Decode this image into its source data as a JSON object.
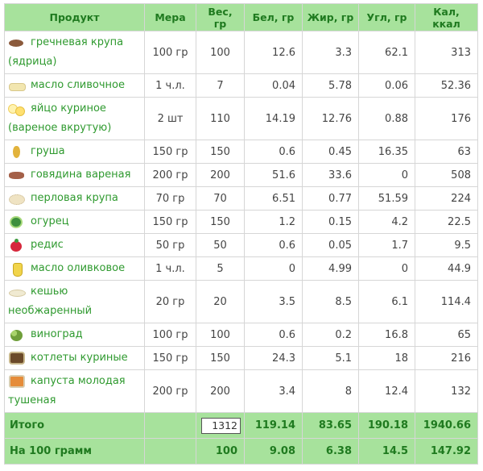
{
  "columns": [
    "Продукт",
    "Мера",
    "Вес, гр",
    "Бел, гр",
    "Жир, гр",
    "Угл, гр",
    "Кал, ккал"
  ],
  "rows": [
    {
      "icon": "buckwheat-icon",
      "name": "гречневая крупа (ядрица)",
      "measure": "100 гр",
      "weight": "100",
      "protein": "12.6",
      "fat": "3.3",
      "carbs": "62.1",
      "kcal": "313"
    },
    {
      "icon": "butter-icon",
      "name": "масло сливочное",
      "measure": "1 ч.л.",
      "weight": "7",
      "protein": "0.04",
      "fat": "5.78",
      "carbs": "0.06",
      "kcal": "52.36"
    },
    {
      "icon": "egg-icon",
      "name": "яйцо куриное (вареное вкрутую)",
      "measure": "2 шт",
      "weight": "110",
      "protein": "14.19",
      "fat": "12.76",
      "carbs": "0.88",
      "kcal": "176"
    },
    {
      "icon": "pear-icon",
      "name": "груша",
      "measure": "150 гр",
      "weight": "150",
      "protein": "0.6",
      "fat": "0.45",
      "carbs": "16.35",
      "kcal": "63"
    },
    {
      "icon": "beef-icon",
      "name": "говядина вареная",
      "measure": "200 гр",
      "weight": "200",
      "protein": "51.6",
      "fat": "33.6",
      "carbs": "0",
      "kcal": "508"
    },
    {
      "icon": "barley-icon",
      "name": "перловая крупа",
      "measure": "70 гр",
      "weight": "70",
      "protein": "6.51",
      "fat": "0.77",
      "carbs": "51.59",
      "kcal": "224"
    },
    {
      "icon": "cucumber-icon",
      "name": "огурец",
      "measure": "150 гр",
      "weight": "150",
      "protein": "1.2",
      "fat": "0.15",
      "carbs": "4.2",
      "kcal": "22.5"
    },
    {
      "icon": "radish-icon",
      "name": "редис",
      "measure": "50 гр",
      "weight": "50",
      "protein": "0.6",
      "fat": "0.05",
      "carbs": "1.7",
      "kcal": "9.5"
    },
    {
      "icon": "olive-oil-icon",
      "name": "масло оливковое",
      "measure": "1 ч.л.",
      "weight": "5",
      "protein": "0",
      "fat": "4.99",
      "carbs": "0",
      "kcal": "44.9"
    },
    {
      "icon": "cashew-icon",
      "name": "кешью необжаренный",
      "measure": "20 гр",
      "weight": "20",
      "protein": "3.5",
      "fat": "8.5",
      "carbs": "6.1",
      "kcal": "114.4"
    },
    {
      "icon": "grape-icon",
      "name": "виноград",
      "measure": "100 гр",
      "weight": "100",
      "protein": "0.6",
      "fat": "0.2",
      "carbs": "16.8",
      "kcal": "65"
    },
    {
      "icon": "cutlet-icon",
      "name": "котлеты куриные",
      "measure": "150 гр",
      "weight": "150",
      "protein": "24.3",
      "fat": "5.1",
      "carbs": "18",
      "kcal": "216"
    },
    {
      "icon": "cabbage-icon",
      "name": "капуста молодая тушеная",
      "measure": "200 гр",
      "weight": "200",
      "protein": "3.4",
      "fat": "8",
      "carbs": "12.4",
      "kcal": "132"
    }
  ],
  "total": {
    "label": "Итого",
    "weight": "1312",
    "protein": "119.14",
    "fat": "83.65",
    "carbs": "190.18",
    "kcal": "1940.66"
  },
  "per100": {
    "label": "На 100 грамм",
    "weight": "100",
    "protein": "9.08",
    "fat": "6.38",
    "carbs": "14.5",
    "kcal": "147.92"
  },
  "colors": {
    "header_bg": "#a7e29c",
    "header_text": "#1f7a1f",
    "link_green": "#2f9a2f"
  }
}
